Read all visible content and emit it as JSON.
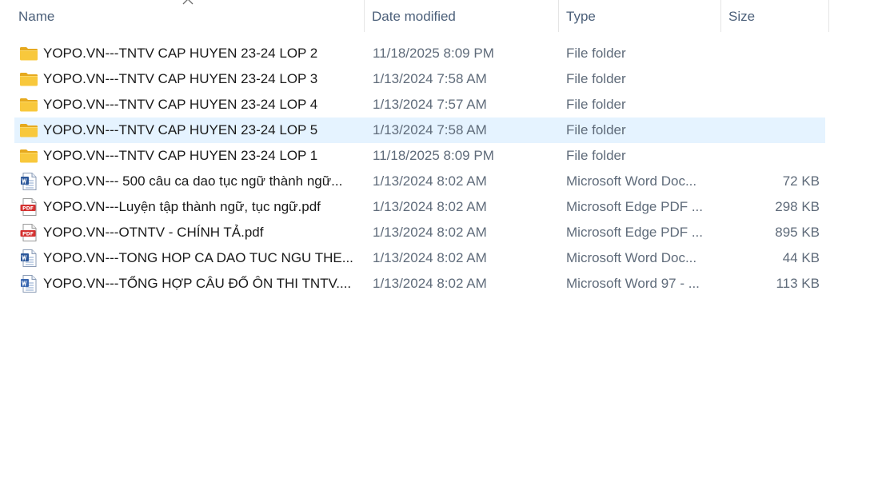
{
  "columns": {
    "name": "Name",
    "date": "Date modified",
    "type": "Type",
    "size": "Size"
  },
  "files": [
    {
      "icon": "folder-icon",
      "name": "YOPO.VN---TNTV CAP HUYEN 23-24  LOP 2",
      "date": "11/18/2025 8:09 PM",
      "type": "File folder",
      "size": ""
    },
    {
      "icon": "folder-icon",
      "name": "YOPO.VN---TNTV CAP HUYEN 23-24  LOP 3",
      "date": "1/13/2024 7:58 AM",
      "type": "File folder",
      "size": ""
    },
    {
      "icon": "folder-icon",
      "name": "YOPO.VN---TNTV CAP HUYEN 23-24  LOP 4",
      "date": "1/13/2024 7:57 AM",
      "type": "File folder",
      "size": ""
    },
    {
      "icon": "folder-icon",
      "name": "YOPO.VN---TNTV CAP HUYEN 23-24  LOP 5",
      "date": "1/13/2024 7:58 AM",
      "type": "File folder",
      "size": "",
      "selected": true
    },
    {
      "icon": "folder-icon",
      "name": "YOPO.VN---TNTV CAP HUYEN 23-24 LOP 1",
      "date": "11/18/2025 8:09 PM",
      "type": "File folder",
      "size": ""
    },
    {
      "icon": "word-doc-icon",
      "name": "YOPO.VN--- 500 câu ca dao tục ngữ thành ngữ...",
      "date": "1/13/2024 8:02 AM",
      "type": "Microsoft Word Doc...",
      "size": "72 KB"
    },
    {
      "icon": "pdf-icon",
      "name": "YOPO.VN---Luyện tập thành ngữ, tục ngữ.pdf",
      "date": "1/13/2024 8:02 AM",
      "type": "Microsoft Edge PDF ...",
      "size": "298 KB"
    },
    {
      "icon": "pdf-icon",
      "name": "YOPO.VN---OTNTV - CHÍNH TẢ.pdf",
      "date": "1/13/2024 8:02 AM",
      "type": "Microsoft Edge PDF ...",
      "size": "895 KB"
    },
    {
      "icon": "word-doc-icon",
      "name": "YOPO.VN---TONG HOP CA DAO TUC NGU THE...",
      "date": "1/13/2024 8:02 AM",
      "type": "Microsoft Word Doc...",
      "size": "44 KB"
    },
    {
      "icon": "word97-doc-icon",
      "name": "YOPO.VN---TỔNG HỢP CÂU ĐỐ ÔN THI TNTV....",
      "date": "1/13/2024 8:02 AM",
      "type": "Microsoft Word 97 - ...",
      "size": "113 KB"
    }
  ],
  "colors": {
    "selection": "#e5f3ff",
    "folder": "#f8c83c",
    "word": "#2b579a",
    "pdf": "#d4302f"
  }
}
